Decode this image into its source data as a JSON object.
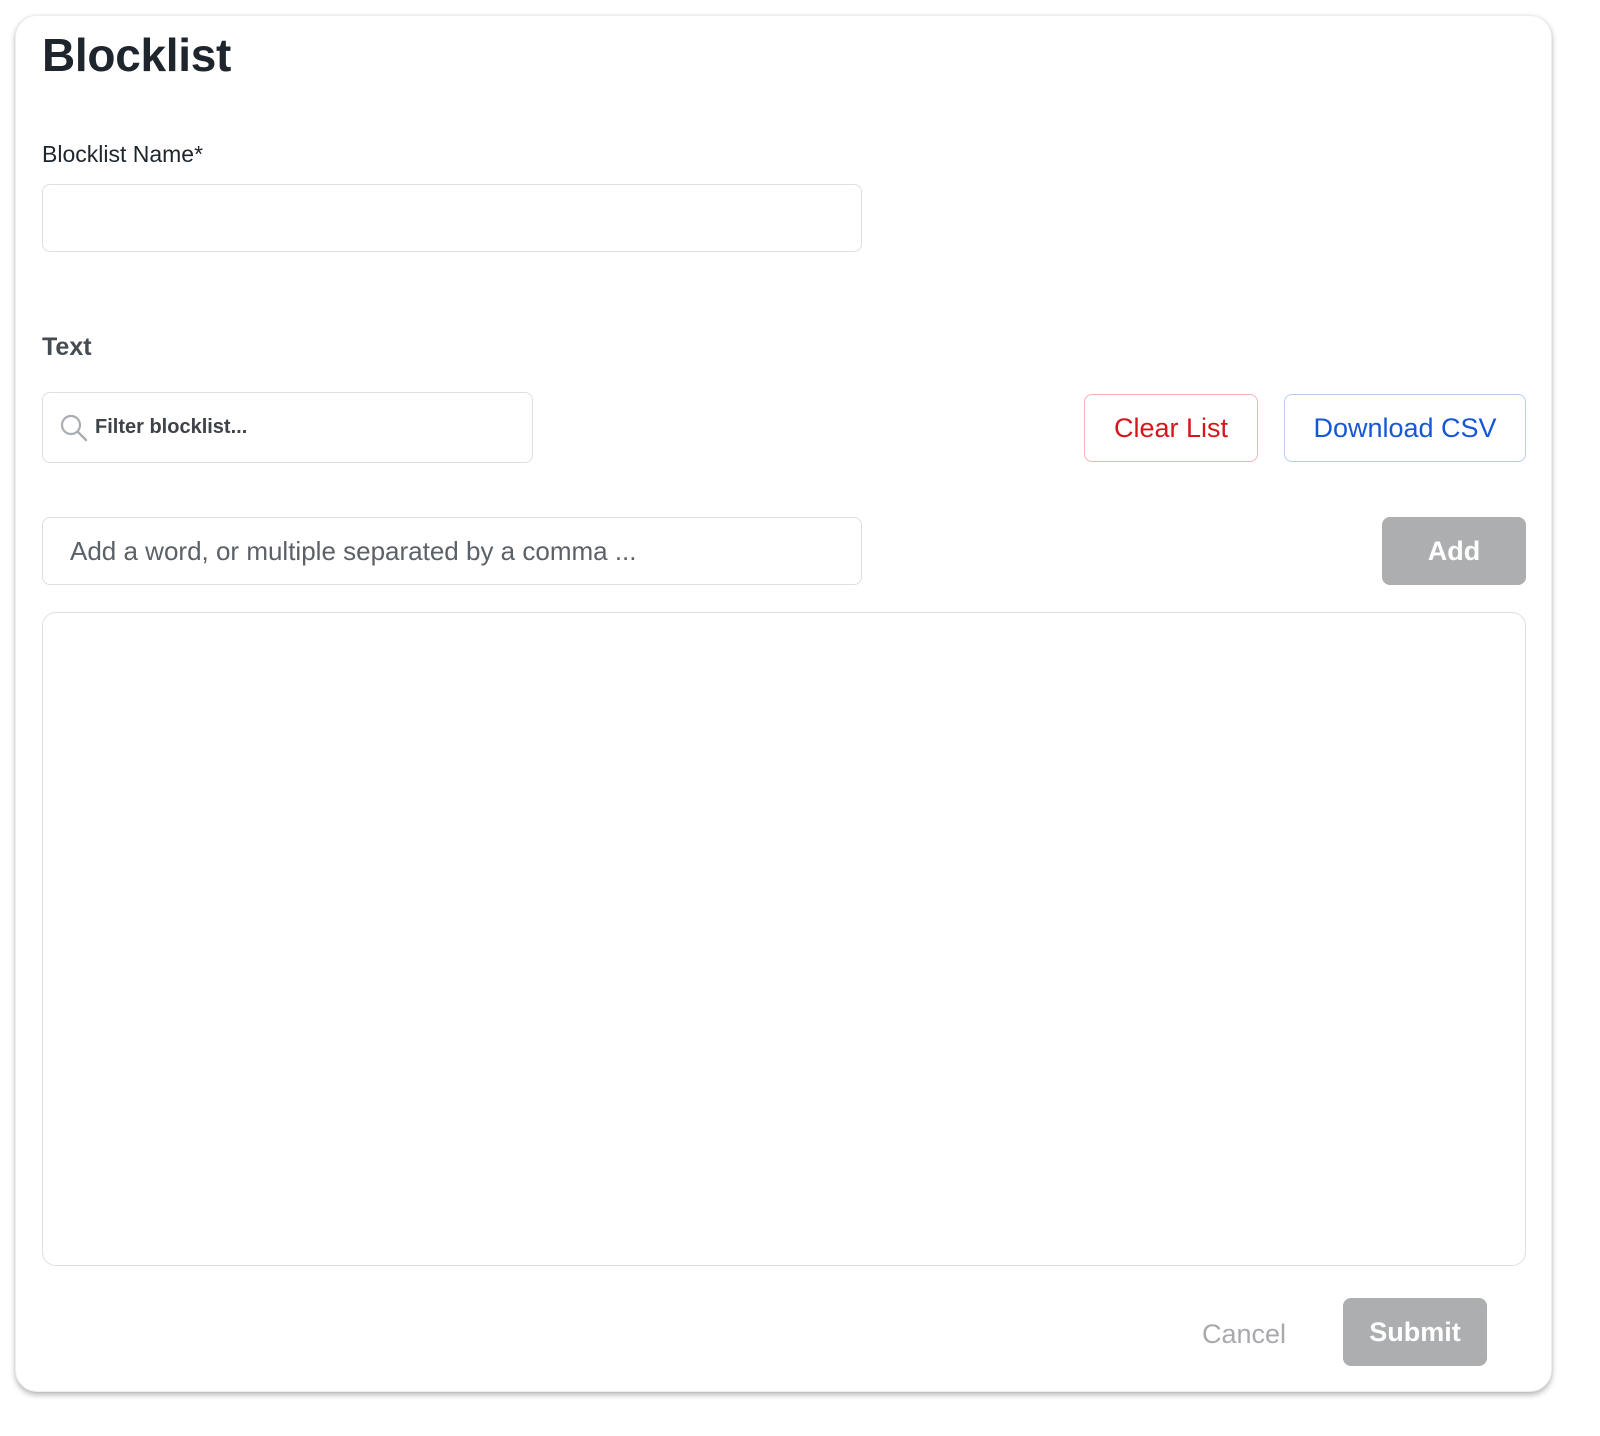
{
  "form": {
    "title": "Blocklist",
    "name_label": "Blocklist Name*",
    "name_value": "",
    "section_title": "Text",
    "filter_placeholder": "Filter blocklist...",
    "clear_label": "Clear List",
    "download_label": "Download CSV",
    "word_placeholder": "Add a word, or multiple separated by a comma ...",
    "add_label": "Add",
    "items": [],
    "cancel_label": "Cancel",
    "submit_label": "Submit"
  },
  "icons": {
    "filter": "search-icon"
  },
  "colors": {
    "danger": "#d6161c",
    "primary": "#1657d6",
    "disabled_button": "#acaeb0"
  }
}
